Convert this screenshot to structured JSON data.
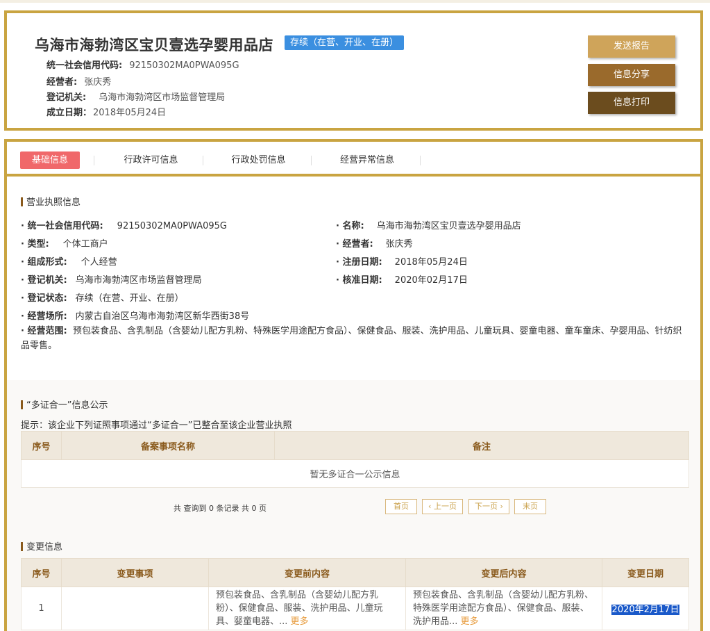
{
  "header": {
    "title": "乌海市海勃湾区宝贝壹选孕婴用品店",
    "status": "存续（在营、开业、在册）",
    "rows": [
      {
        "label": "统一社会信用代码:",
        "value": "92150302MA0PWA095G"
      },
      {
        "label": "经营者:",
        "value": "张庆秀"
      },
      {
        "label": "登记机关:",
        "value": "乌海市海勃湾区市场监督管理局"
      },
      {
        "label": "成立日期：",
        "value": "2018年05月24日"
      }
    ],
    "buttons": {
      "report": "发送报告",
      "share": "信息分享",
      "print": "信息打印"
    }
  },
  "tabs": [
    "基础信息",
    "行政许可信息",
    "行政处罚信息",
    "经营异常信息"
  ],
  "license": {
    "title": "营业执照信息",
    "left": [
      {
        "label": "· 统一社会信用代码:",
        "value": "92150302MA0PWA095G"
      },
      {
        "label": "· 类型:",
        "value": "个体工商户"
      },
      {
        "label": "· 组成形式:",
        "value": "个人经营"
      },
      {
        "label": "· 登记机关:",
        "value": "乌海市海勃湾区市场监督管理局"
      },
      {
        "label": "· 登记状态:",
        "value": "存续（在营、开业、在册）"
      },
      {
        "label": "· 经营场所:",
        "value": "内蒙古自治区乌海市海勃湾区新华西街38号"
      }
    ],
    "right": [
      {
        "label": "· 名称:",
        "value": "乌海市海勃湾区宝贝壹选孕婴用品店"
      },
      {
        "label": "· 经营者:",
        "value": "张庆秀"
      },
      {
        "label": "· 注册日期:",
        "value": "2018年05月24日"
      },
      {
        "label": "· 核准日期:",
        "value": "2020年02月17日"
      }
    ],
    "scope_label": "· 经营范围:",
    "scope_value": "预包装食品、含乳制品（含婴幼儿配方乳粉、特殊医学用途配方食品）、保健食品、服装、洗护用品、儿童玩具、婴童电器、童车童床、孕婴用品、针纺织品零售。"
  },
  "multi": {
    "title": "“多证合一”信息公示",
    "notice": "提示：该企业下列证照事项通过“多证合一”已整合至该企业营业执照",
    "headers": [
      "序号",
      "备案事项名称",
      "备注"
    ],
    "empty": "暂无多证合一公示信息",
    "pager_info": "共 查询到 0 条记录 共 0 页",
    "pager": [
      "首页",
      "上一页",
      "下一页",
      "末页"
    ]
  },
  "changes": {
    "title": "变更信息",
    "headers": [
      "序号",
      "变更事项",
      "变更前内容",
      "变更后内容",
      "变更日期"
    ],
    "rows": [
      {
        "no": "1",
        "item": "",
        "before": "预包装食品、含乳制品（含婴幼儿配方乳粉）、保健食品、服装、洗护用品、儿童玩具、婴童电器、...",
        "after": "预包装食品、含乳制品（含婴幼儿配方乳粉、特殊医学用途配方食品）、保健食品、服装、洗护用品...",
        "more": "更多",
        "date": "2020年2月17日"
      }
    ]
  }
}
